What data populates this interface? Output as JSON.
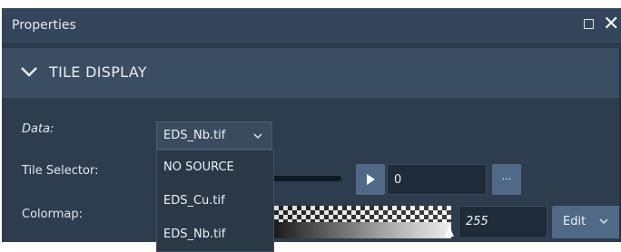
{
  "window": {
    "title": "Properties",
    "maximize_icon": "square-icon",
    "close_icon": "close-icon"
  },
  "section": {
    "title": "TILE DISPLAY",
    "toggle_icon": "chevron-down-icon"
  },
  "data_row": {
    "label": "Data:",
    "selected": "EDS_Nb.tif",
    "options": [
      "NO SOURCE",
      "EDS_Cu.tif",
      "EDS_Nb.tif"
    ]
  },
  "tile_selector": {
    "label": "Tile Selector:",
    "value": "0",
    "more_label": "..."
  },
  "colormap": {
    "label": "Colormap:",
    "max_value": "255",
    "edit_label": "Edit"
  },
  "colors": {
    "panel_bg": "#2e3d4e",
    "section_bg": "#3b4d62",
    "button_bg": "#4f6986",
    "input_bg": "#1f2b38"
  }
}
